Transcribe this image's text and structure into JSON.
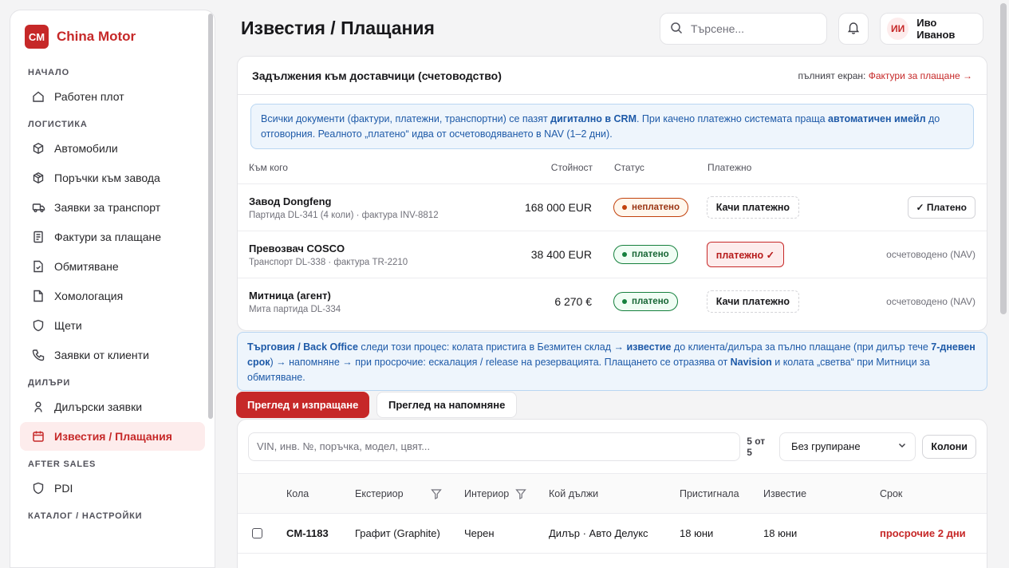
{
  "brand": {
    "logo": "CM",
    "name": "China Motor"
  },
  "sidebar": {
    "sections": [
      {
        "title": "НАЧАЛО",
        "items": [
          {
            "label": "Работен плот",
            "icon": "home-icon"
          }
        ]
      },
      {
        "title": "ЛОГИСТИКА",
        "items": [
          {
            "label": "Автомобили",
            "icon": "box-icon"
          },
          {
            "label": "Поръчки към завода",
            "icon": "package-icon"
          },
          {
            "label": "Заявки за транспорт",
            "icon": "truck-icon"
          },
          {
            "label": "Фактури за плащане",
            "icon": "receipt-icon"
          },
          {
            "label": "Обмитяване",
            "icon": "file-check-icon"
          },
          {
            "label": "Хомологация",
            "icon": "file-icon"
          },
          {
            "label": "Щети",
            "icon": "shield-icon"
          },
          {
            "label": "Заявки от клиенти",
            "icon": "phone-icon"
          }
        ]
      },
      {
        "title": "ДИЛЪРИ",
        "items": [
          {
            "label": "Дилърски заявки",
            "icon": "person-icon"
          },
          {
            "label": "Известия / Плащания",
            "icon": "calendar-icon",
            "active": true
          }
        ]
      },
      {
        "title": "AFTER SALES",
        "items": [
          {
            "label": "PDI",
            "icon": "shield-icon"
          }
        ]
      },
      {
        "title": "КАТАЛОГ / НАСТРОЙКИ",
        "items": []
      }
    ]
  },
  "header": {
    "title": "Известия / Плащания",
    "search_placeholder": "Търсене...",
    "user_initials": "ИИ",
    "user_name": "Иво Иванов"
  },
  "payables": {
    "title": "Задължения към доставчици (счетоводство)",
    "fullscreen_prefix": "пълният екран:",
    "fullscreen_link": "Фактури за плащане →",
    "info": {
      "t1": "Всички документи (фактури, платежни, транспортни) се пазят ",
      "b1": "дигитално в CRM",
      "t2": ". При качено платежно системата праща ",
      "b2": "автоматичен имейл",
      "t3": " до отговорния. Реалното „платено“ идва от осчетоводяването в NAV (1–2 дни)."
    },
    "columns": {
      "who": "Към кого",
      "value": "Стойност",
      "status": "Статус",
      "payment": "Платежно"
    },
    "rows": [
      {
        "name": "Завод Dongfeng",
        "sub": "Партида DL-341 (4 коли) · фактура INV-8812",
        "value": "168 000 EUR",
        "status": "неплатено",
        "payment": "Качи платежно",
        "action": "✓ Платено"
      },
      {
        "name": "Превозвач COSCO",
        "sub": "Транспорт DL-338 · фактура TR-2210",
        "value": "38 400 EUR",
        "status": "платено",
        "payment": "платежно ✓",
        "action": "осчетоводено (NAV)"
      },
      {
        "name": "Митница (агент)",
        "sub": "Мита партида DL-334",
        "value": "6 270 €",
        "status": "платено",
        "payment": "Качи платежно",
        "action": "осчетоводено (NAV)"
      }
    ]
  },
  "process_info": {
    "b1": "Търговия / Back Office",
    "t1": " следи този процес: колата пристига в Безмитен склад → ",
    "b2": "известие",
    "t2": " до клиента/дилъра за пълно плащане (при дилър тече ",
    "b3": "7-дневен срок",
    "t3": ") → напомняне → при просрочие: ескалация / release на резервацията. Плащането се отразява от ",
    "b4": "Navision",
    "t4": " и колата „светва“ при Митници за обмитяване."
  },
  "tabs": {
    "active": "Преглед и изпращане",
    "inactive": "Преглед на напомняне"
  },
  "notices": {
    "filter_placeholder": "VIN, инв. №, поръчка, модел, цвят...",
    "count": "5 от 5",
    "grouping": "Без групиране",
    "columns_button": "Колони",
    "columns": {
      "car": "Кола",
      "exterior": "Екстериор",
      "interior": "Интериор",
      "debtor": "Кой дължи",
      "arrived": "Пристигнала",
      "notice": "Известие",
      "deadline": "Срок"
    },
    "rows": [
      {
        "car": "CM-1183",
        "exterior": "Графит (Graphite)",
        "interior": "Черен",
        "debtor": "Дилър · Авто Делукс",
        "arrived": "18 юни",
        "notice": "18 юни",
        "deadline": "просрочие 2 дни"
      }
    ]
  },
  "colors": {
    "accent": "#c62828",
    "info_bg": "#eef5fc",
    "info_text": "#1e5aa8",
    "unpaid": "#c2410c",
    "paid": "#15803d"
  }
}
